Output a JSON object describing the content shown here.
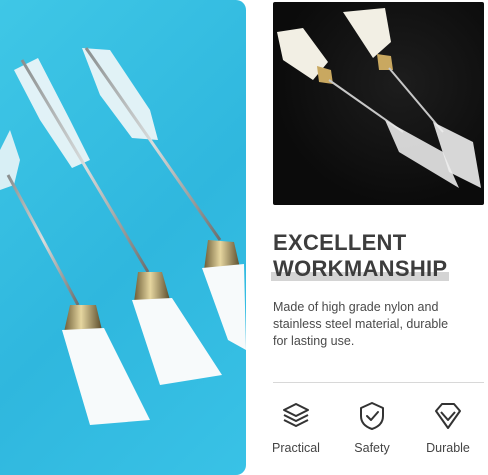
{
  "headline": {
    "line1": "EXCELLENT",
    "line2": "WORKMANSHIP"
  },
  "description": "Made of high grade nylon and stainless steel material, durable for lasting use.",
  "features": [
    {
      "icon": "layers-icon",
      "label": "Practical"
    },
    {
      "icon": "shield-check-icon",
      "label": "Safety"
    },
    {
      "icon": "diamond-icon",
      "label": "Durable"
    }
  ],
  "colors": {
    "left_background": "#36bfe3",
    "right_background": "#0e0e0e",
    "text_dark": "#3d3d3d",
    "highlight_bar": "#d4d4d4"
  }
}
